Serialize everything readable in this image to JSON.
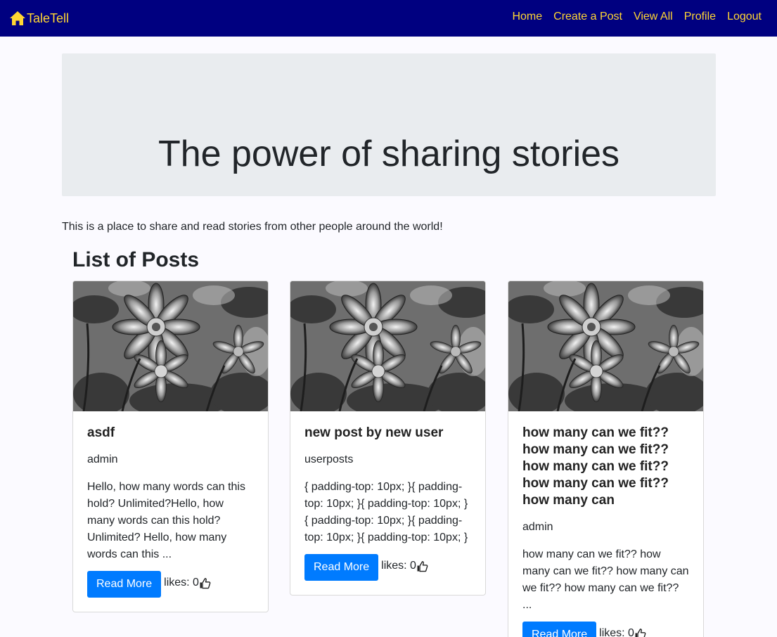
{
  "navbar": {
    "brand": "TaleTell",
    "links": [
      "Home",
      "Create a Post",
      "View All",
      "Profile",
      "Logout"
    ]
  },
  "hero": {
    "heading": "The power of sharing stories"
  },
  "intro": "This is a place to share and read stories from other people around the world!",
  "section_title": "List of Posts",
  "posts": [
    {
      "title": "asdf",
      "author": "admin",
      "excerpt": "Hello, how many words can this hold? Unlimited?Hello, how many words can this hold? Unlimited? Hello, how many words can this ...",
      "button": "Read More",
      "likes_label": "likes: 0"
    },
    {
      "title": "new post by new user",
      "author": "userposts",
      "excerpt": "{ padding-top: 10px; }{ padding-top: 10px; }{ padding-top: 10px; }{ padding-top: 10px; }{ padding-top: 10px; }{ padding-top: 10px; }",
      "button": "Read More",
      "likes_label": "likes: 0"
    },
    {
      "title": "how many can we fit?? how many can we fit?? how many can we fit?? how many can we fit?? how many can",
      "author": "admin",
      "excerpt": "how many can we fit?? how many can we fit?? how many can we fit?? how many can we fit?? ...",
      "button": "Read More",
      "likes_label": "likes: 0"
    }
  ],
  "colors": {
    "navbar_bg": "#000080",
    "nav_text": "#ffd633",
    "button_bg": "#007bff",
    "hero_bg": "#e9ecef"
  },
  "icons": {
    "brand": "home-icon",
    "likes": "thumbs-up-icon"
  }
}
